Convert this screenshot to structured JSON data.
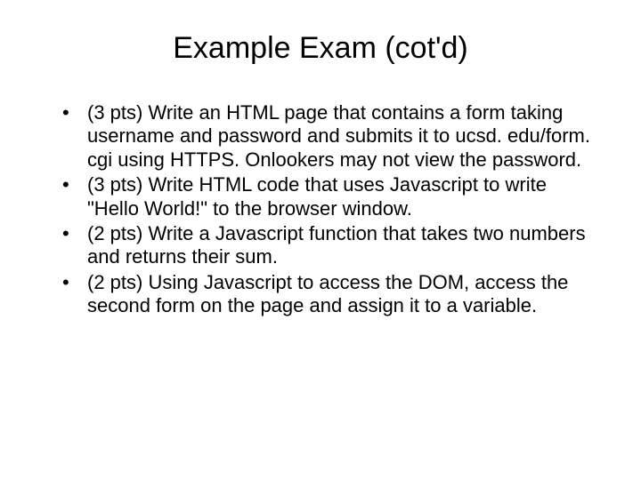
{
  "slide": {
    "title": "Example Exam (cot'd)",
    "bullets": [
      "(3 pts) Write an HTML page that contains a form taking username and password and submits it to ucsd. edu/form. cgi using HTTPS. Onlookers may not view the password.",
      "(3 pts) Write HTML code that uses Javascript to write \"Hello World!\" to the browser window.",
      "(2 pts) Write a Javascript function that takes two numbers and returns their sum.",
      "(2 pts) Using Javascript to access the DOM, access the second form on the page and assign it to a variable."
    ]
  }
}
